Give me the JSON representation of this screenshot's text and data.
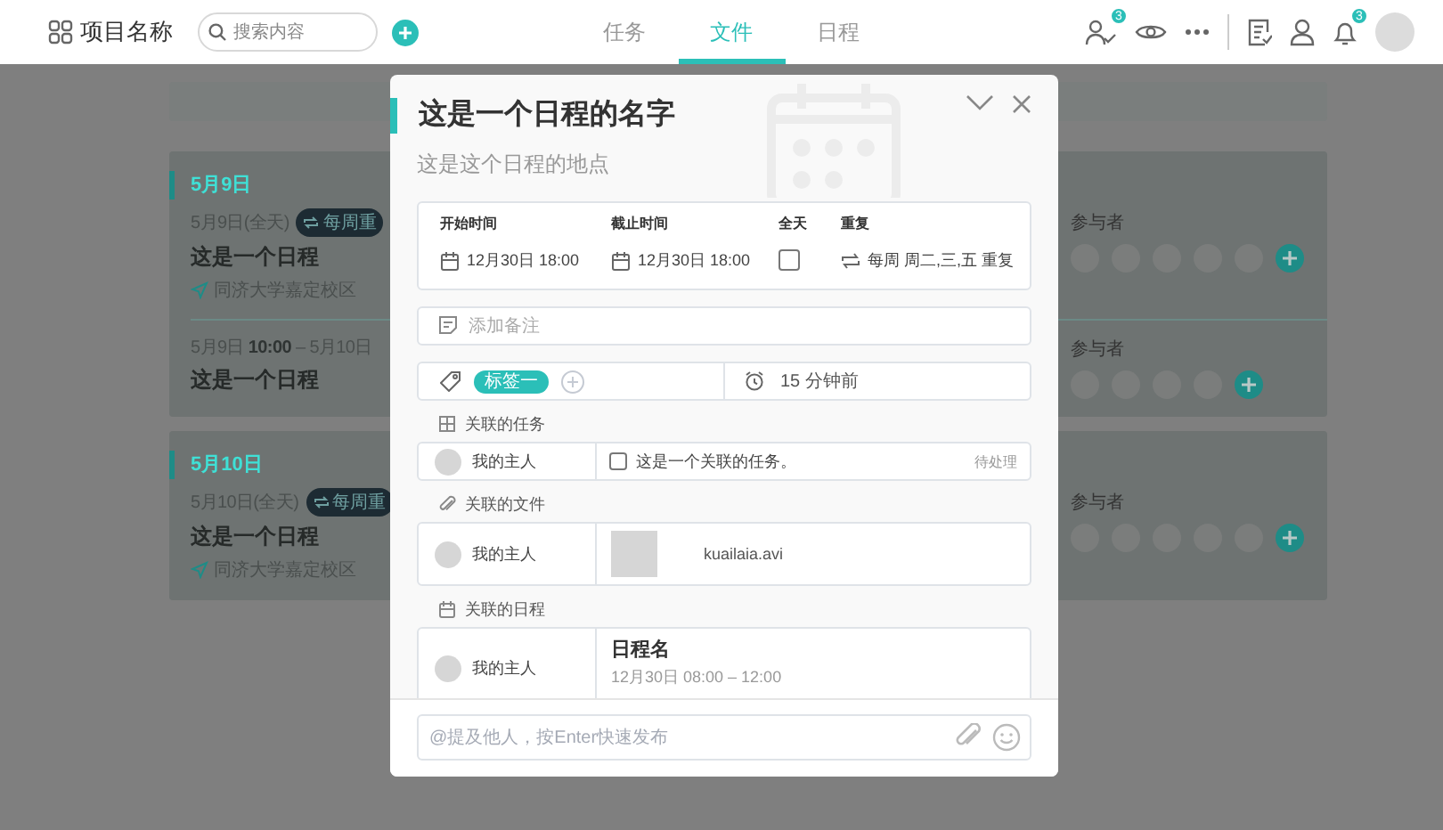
{
  "topbar": {
    "project": "项目名称",
    "search": {
      "placeholder": "搜索内容"
    },
    "tabs": [
      {
        "label": "任务",
        "selected": false
      },
      {
        "label": "文件",
        "selected": true
      },
      {
        "label": "日程",
        "selected": false
      }
    ],
    "toolbar": [
      {
        "kind": "members",
        "badge": "3"
      },
      {
        "kind": "eye"
      },
      {
        "kind": "more"
      },
      {
        "kind": "divider"
      },
      {
        "kind": "document"
      },
      {
        "kind": "user"
      },
      {
        "kind": "bell",
        "badge": "3"
      },
      {
        "kind": "avatar"
      }
    ]
  },
  "days": [
    {
      "date": "5月9日",
      "events": [
        {
          "time": "5月9日(全天)",
          "repeat": "每周重",
          "title": "这是一个日程",
          "location": "同济大学嘉定校区",
          "participants_label": "参与者",
          "participants": [
            {
              "kind": "avatar"
            },
            {
              "kind": "avatar"
            },
            {
              "kind": "avatar"
            },
            {
              "kind": "avatar"
            },
            {
              "kind": "avatar"
            },
            {
              "kind": "add"
            }
          ]
        },
        {
          "time": "5月9日 **10:00** – 5月10日",
          "title": "这是一个日程",
          "participants_label": "参与者",
          "participants": [
            {
              "kind": "avatar"
            },
            {
              "kind": "avatar"
            },
            {
              "kind": "avatar"
            },
            {
              "kind": "avatar"
            },
            {
              "kind": "add"
            }
          ]
        }
      ]
    },
    {
      "date": "5月10日",
      "events": [
        {
          "time": "5月10日(全天)",
          "repeat": "每周重",
          "title": "这是一个日程",
          "location": "同济大学嘉定校区",
          "participants_label": "参与者",
          "participants": [
            {
              "kind": "avatar"
            },
            {
              "kind": "avatar"
            },
            {
              "kind": "avatar"
            },
            {
              "kind": "avatar"
            },
            {
              "kind": "avatar"
            },
            {
              "kind": "add"
            }
          ]
        }
      ]
    }
  ],
  "modal": {
    "title": "这是一个日程的名字",
    "location": "这是这个日程的地点",
    "start_label": "开始时间",
    "start_value": "12月30日 18:00",
    "end_label": "截止时间",
    "end_value": "12月30日 18:00",
    "all_day_label": "全天",
    "all_day": false,
    "repeat_label": "重复",
    "repeat_value": "每周 周二,三,五 重复",
    "note": {
      "placeholder": "添加备注"
    },
    "tags": [
      {
        "label": "标签一"
      }
    ],
    "reminder": "15 分钟前",
    "sections": [
      {
        "kind": "task",
        "title": "关联的任务",
        "owner": "我的主人",
        "checked": false,
        "text": "这是一个关联的任务。",
        "status": "待处理"
      },
      {
        "kind": "file",
        "title": "关联的文件",
        "owner": "我的主人",
        "file": "kuailaia.avi"
      },
      {
        "kind": "schedule",
        "title": "关联的日程",
        "owner": "我的主人",
        "name": "日程名",
        "time": "12月30日 08:00 – 12:00"
      }
    ],
    "comment": {
      "placeholder": "@提及他人，按Enter快速发布"
    }
  }
}
